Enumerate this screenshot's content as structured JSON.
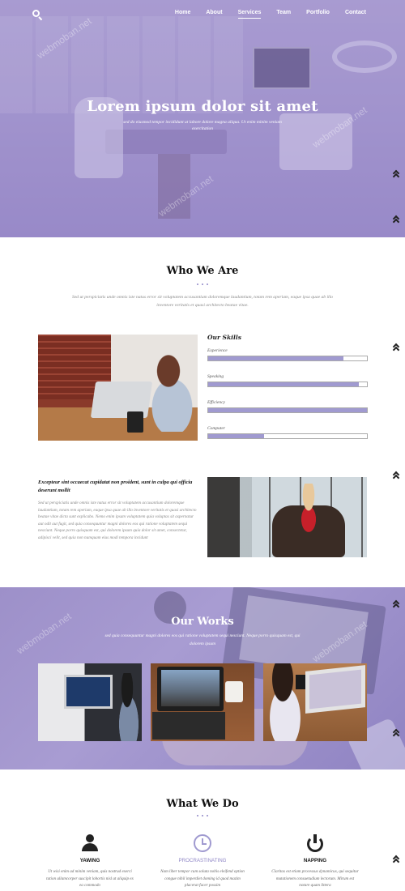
{
  "nav": {
    "items": [
      "Home",
      "About",
      "Services",
      "Team",
      "Portfolio",
      "Contact"
    ],
    "active": "Services"
  },
  "hero": {
    "title": "Lorem ipsum dolor sit amet",
    "subtitle": "sed do eiusmod tempor incididunt ut labore dolore magna aliqua. Ut enim minim veniam exercitation"
  },
  "who": {
    "title": "Who We Are",
    "intro": "Sed ut perspiciatis unde omnis iste natus error sit voluptatem accusantium doloremque laudantium, totam rem aperiam, eaque ipsa quae ab illo inventore veritatis et quasi architecto beatae vitae.",
    "skills_title": "Our Skills",
    "skills": [
      {
        "label": "Experience",
        "value": 85
      },
      {
        "label": "Speaking",
        "value": 95
      },
      {
        "label": "Efficiency",
        "value": 100
      },
      {
        "label": "Computer",
        "value": 35
      }
    ],
    "promo_title": "Excepteur sint occaecat cupidatat non proident, sunt in culpa qui officia deserunt mollit",
    "promo_text": "Sed ut perspiciatis unde omnis iste natus error sit voluptatem accusantium doloremque laudantium, totam rem aperiam, eaque ipsa quae ab illo inventore veritatis et quasi architecto beatae vitae dicta sunt explicabo. Nemo enim ipsam voluptatem quia voluptas sit aspernatur aut odit aut fugit, sed quia consequuntur magni dolores eos qui ratione voluptatem sequi nesciunt. Neque porro quisquam est, qui dolorem ipsum quia dolor sit amet, consectetur, adipisci velit, sed quia non numquam eius modi tempora incidunt"
  },
  "works": {
    "title": "Our Works",
    "subtitle": "sed quia consequuntur magni dolores eos qui ratione voluptatem sequi nesciunt. Neque porro quisquam est, qui dolorem ipsum"
  },
  "what": {
    "title": "What We Do",
    "services": [
      {
        "name": "YAWING",
        "desc": "Ut wisi enim ad minim veniam, quis nostrud exerci tation ullamcorper suscipit lobortis nisl ut aliquip ex ea commodo"
      },
      {
        "name": "PROCRASTINATING",
        "desc": "Nam liber tempor cum soluta nobis eleifend option congue nihil imperdiet doming id quod mazim placerat facer possim"
      },
      {
        "name": "NAPPING",
        "desc": "Claritas est etiam processus dynamicus, qui sequitur mutationem consuetudium lectorum. Mirum est notare quam littera"
      }
    ]
  },
  "watermark": "webmoban.net",
  "colors": {
    "accent": "#a09ad0",
    "hero_tint": "#9a8dc8"
  }
}
